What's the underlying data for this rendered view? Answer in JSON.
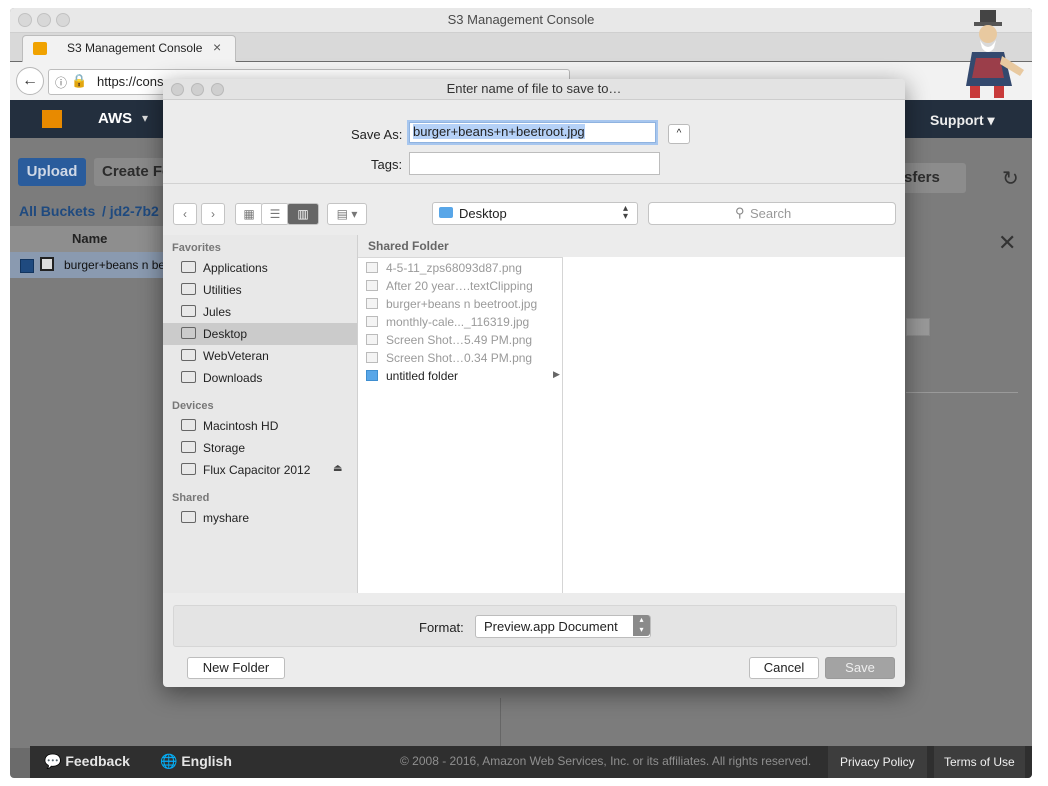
{
  "window": {
    "title": "S3 Management Console"
  },
  "tab": {
    "title": "S3 Management Console",
    "close": "×"
  },
  "toolbar": {
    "url": "https://cons"
  },
  "aws_header": {
    "brand": "AWS",
    "support": "Support"
  },
  "s3": {
    "upload": "Upload",
    "create_folder": "Create Fo",
    "all_buckets": "All Buckets",
    "bucket_crumb": "/  jd2-7b2",
    "name_col": "Name",
    "file_row": "burger+beans n be",
    "transfers": "sfers"
  },
  "footer": {
    "feedback": "Feedback",
    "english": "English",
    "copyright": "© 2008 - 2016, Amazon Web Services, Inc. or its affiliates. All rights reserved.",
    "privacy": "Privacy Policy",
    "terms": "Terms of Use"
  },
  "dialog": {
    "title": "Enter name of file to save to…",
    "save_as_label": "Save As:",
    "save_as_value": "burger+beans+n+beetroot.jpg",
    "tags_label": "Tags:",
    "location": "Desktop",
    "search_placeholder": "Search",
    "favorites_label": "Favorites",
    "favorites": [
      "Applications",
      "Utilities",
      "Jules",
      "Desktop",
      "WebVeteran",
      "Downloads"
    ],
    "devices_label": "Devices",
    "devices": [
      "Macintosh HD",
      "Storage",
      "Flux Capacitor 2012"
    ],
    "shared_label": "Shared",
    "shared": [
      "myshare"
    ],
    "column_header": "Shared Folder",
    "files": [
      "4-5-11_zps68093d87.png",
      "After 20 year….textClipping",
      "burger+beans n beetroot.jpg",
      "monthly-cale..._116319.jpg",
      "Screen Shot…5.49 PM.png",
      "Screen Shot…0.34 PM.png"
    ],
    "folder": "untitled folder",
    "format_label": "Format:",
    "format_value": "Preview.app Document",
    "new_folder": "New Folder",
    "cancel": "Cancel",
    "save": "Save"
  }
}
